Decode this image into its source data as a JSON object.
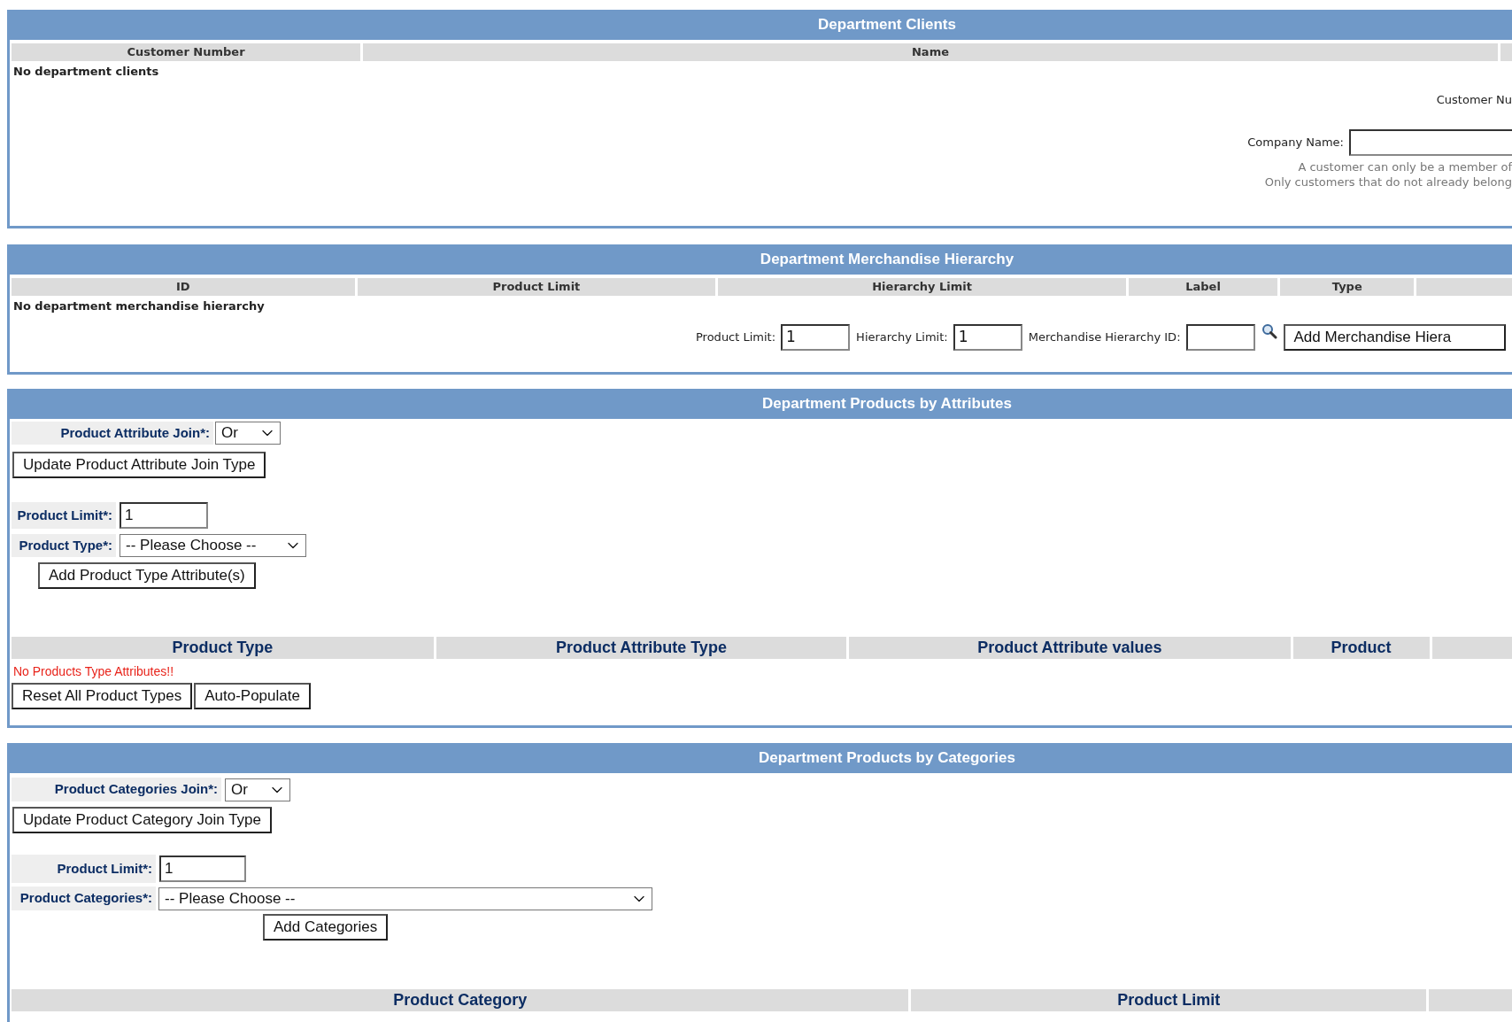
{
  "clients": {
    "title": "Department Clients",
    "columns": [
      "Customer Number",
      "Name"
    ],
    "empty_message": "No department clients",
    "customer_number_label": "Customer Nu",
    "company_name_label": "Company Name:",
    "help_lines": [
      "A customer can only be a member of",
      "Only customers that do not already belong"
    ]
  },
  "merchandise_hierarchy": {
    "title": "Department Merchandise Hierarchy",
    "columns": [
      "ID",
      "Product Limit",
      "Hierarchy Limit",
      "Label",
      "Type"
    ],
    "empty_message": "No department merchandise hierarchy",
    "fields": [
      {
        "label": "Product Limit:",
        "value": "1"
      },
      {
        "label": "Hierarchy Limit:",
        "value": "1"
      },
      {
        "label": "Merchandise Hierarchy ID:"
      }
    ],
    "add_button": "Add Merchandise Hiera"
  },
  "products_by_attributes": {
    "title": "Department Products by Attributes",
    "join": {
      "label": "Product Attribute Join*:",
      "value": "Or"
    },
    "update_button": "Update Product Attribute Join Type",
    "product_limit": {
      "label": "Product Limit*:",
      "value": "1"
    },
    "product_type": {
      "label": "Product Type*:",
      "value": "-- Please Choose --"
    },
    "add_button": "Add Product Type Attribute(s)",
    "columns": [
      "Product Type",
      "Product Attribute Type",
      "Product Attribute values",
      "Product"
    ],
    "empty_message": "No Products Type Attributes!!",
    "buttons": [
      "Reset All Product Types",
      "Auto-Populate"
    ]
  },
  "products_by_categories": {
    "title": "Department Products by Categories",
    "join": {
      "label": "Product Categories Join*:",
      "value": "Or"
    },
    "update_button": "Update Product Category Join Type",
    "product_limit": {
      "label": "Product Limit*:",
      "value": "1"
    },
    "product_categories": {
      "label": "Product Categories*:",
      "value": "-- Please Choose --"
    },
    "add_button": "Add Categories",
    "columns": [
      "Product Category",
      "Product Limit"
    ]
  }
}
